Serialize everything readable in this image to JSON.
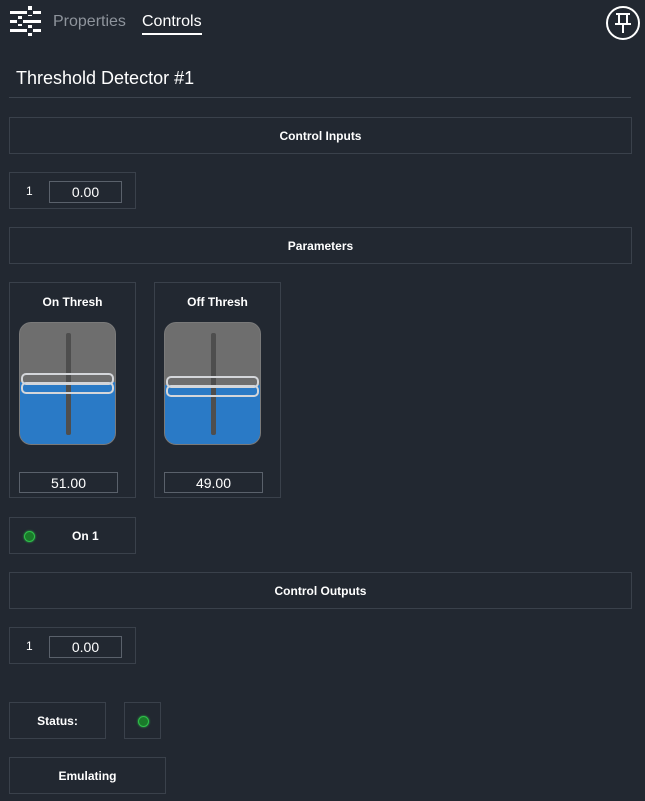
{
  "header": {
    "menu_icon": "sliders-icon",
    "tabs": [
      {
        "label": "Properties",
        "active": false
      },
      {
        "label": "Controls",
        "active": true
      }
    ],
    "pin_icon": "pin-icon"
  },
  "title": "Threshold Detector #1",
  "control_inputs": {
    "label": "Control Inputs",
    "rows": [
      {
        "index": "1",
        "value": "0.00"
      }
    ]
  },
  "parameters": {
    "label": "Parameters",
    "sliders": [
      {
        "label": "On Thresh",
        "value": "51.00",
        "level": 0.51
      },
      {
        "label": "Off Thresh",
        "value": "49.00",
        "level": 0.49
      }
    ]
  },
  "indicator": {
    "label": "On 1",
    "color": "#2fbf4a"
  },
  "control_outputs": {
    "label": "Control Outputs",
    "rows": [
      {
        "index": "1",
        "value": "0.00"
      }
    ]
  },
  "status": {
    "label": "Status:",
    "led_color": "#2fbf4a"
  },
  "mode": {
    "label": "Emulating"
  },
  "colors": {
    "background": "#222831",
    "border": "#3a414b",
    "fill": "#2a7ac6"
  }
}
